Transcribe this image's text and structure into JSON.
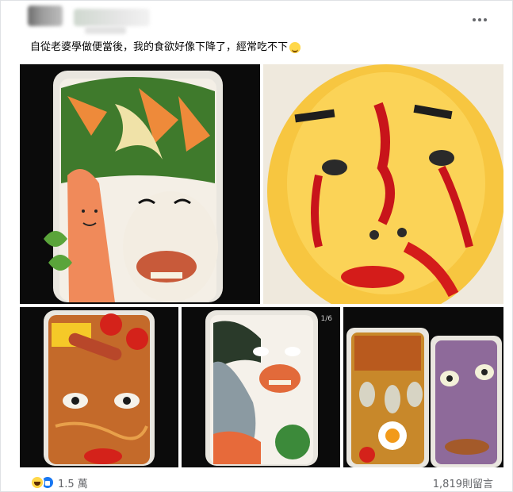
{
  "post": {
    "caption": "自從老婆學做便當後，我的食欲好像下降了，經常吃不下",
    "caption_emoji": "smiling-face-emoji"
  },
  "gallery": {
    "counter": "1/6"
  },
  "footer": {
    "reaction_count": "1.5 萬",
    "comment_count": "1,819則留言"
  },
  "colors": {
    "reaction_like": "#1877f2",
    "reaction_haha": "#f7c843",
    "meta_text": "#65676b",
    "photo_background": "#0c0c0c"
  },
  "icons": [
    "more-options-icon",
    "haha-reaction-icon",
    "like-reaction-icon"
  ]
}
